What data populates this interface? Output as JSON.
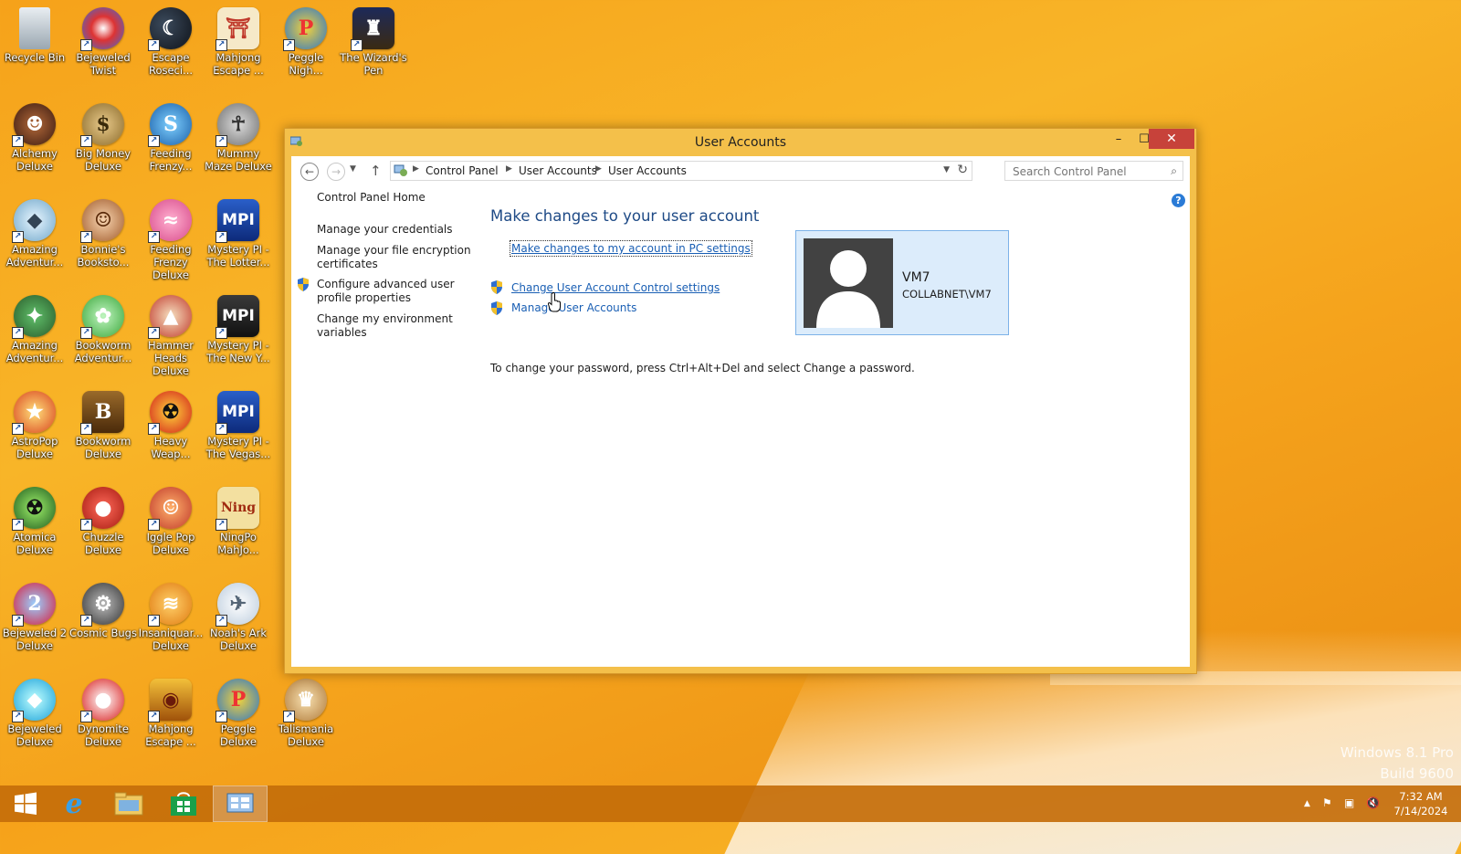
{
  "desktop": {
    "icons": [
      {
        "label": "Recycle Bin"
      },
      {
        "label": "Bejeweled\nTwist"
      },
      {
        "label": "Escape\nRoseci..."
      },
      {
        "label": "Mahjong\nEscape ..."
      },
      {
        "label": "Peggle\nNigh..."
      },
      {
        "label": "The Wizard's\nPen"
      },
      {
        "label": "Alchemy\nDeluxe"
      },
      {
        "label": "Big Money\nDeluxe"
      },
      {
        "label": "Feeding\nFrenzy..."
      },
      {
        "label": "Mummy\nMaze Deluxe"
      },
      {
        "label": "Amazing\nAdventur..."
      },
      {
        "label": "Bonnie's\nBooksto..."
      },
      {
        "label": "Feeding\nFrenzy Deluxe"
      },
      {
        "label": "Mystery PI -\nThe Lotter..."
      },
      {
        "label": "Amazing\nAdventur..."
      },
      {
        "label": "Bookworm\nAdventur..."
      },
      {
        "label": "Hammer\nHeads Deluxe"
      },
      {
        "label": "Mystery PI -\nThe New Y..."
      },
      {
        "label": "AstroPop\nDeluxe"
      },
      {
        "label": "Bookworm\nDeluxe"
      },
      {
        "label": "Heavy\nWeap..."
      },
      {
        "label": "Mystery PI -\nThe Vegas..."
      },
      {
        "label": "Atomica\nDeluxe"
      },
      {
        "label": "Chuzzle\nDeluxe"
      },
      {
        "label": "Iggle Pop\nDeluxe"
      },
      {
        "label": "NingPo\nMahJo..."
      },
      {
        "label": "Bejeweled 2\nDeluxe"
      },
      {
        "label": "Cosmic Bugs"
      },
      {
        "label": "Insaniquar...\nDeluxe"
      },
      {
        "label": "Noah's Ark\nDeluxe"
      },
      {
        "label": "Bejeweled\nDeluxe"
      },
      {
        "label": "Dynomite\nDeluxe"
      },
      {
        "label": "Mahjong\nEscape ..."
      },
      {
        "label": "Peggle\nDeluxe"
      },
      {
        "label": "Talismania\nDeluxe"
      }
    ],
    "watermark": {
      "line1": "Windows 8.1 Pro",
      "line2": "Build 9600"
    }
  },
  "window": {
    "title": "User Accounts",
    "controls": {
      "minimize": "–",
      "maximize": "☐",
      "close": "✕"
    },
    "breadcrumb": [
      "Control Panel",
      "User Accounts",
      "User Accounts"
    ],
    "search": {
      "placeholder": "Search Control Panel"
    },
    "sidebar": {
      "home": "Control Panel Home",
      "credentials": "Manage your credentials",
      "encryption": "Manage your file encryption certificates",
      "advanced_profile": "Configure advanced user profile properties",
      "env_vars": "Change my environment variables"
    },
    "main": {
      "heading": "Make changes to your user account",
      "pc_settings_link": "Make changes to my account in PC settings",
      "uac_link": "Change User Account Control settings",
      "manage_link": "Manage User Accounts",
      "password_note": "To change your password, press Ctrl+Alt+Del and select Change a password."
    },
    "account": {
      "name": "VM7",
      "domain": "COLLABNET\\VM7"
    }
  },
  "taskbar": {
    "clock": {
      "time": "7:32 AM",
      "date": "7/14/2024"
    }
  },
  "colors": {
    "accent": "#f5a31c",
    "link": "#1a5fb4",
    "heading": "#1e4a86",
    "close": "#c7423a"
  }
}
